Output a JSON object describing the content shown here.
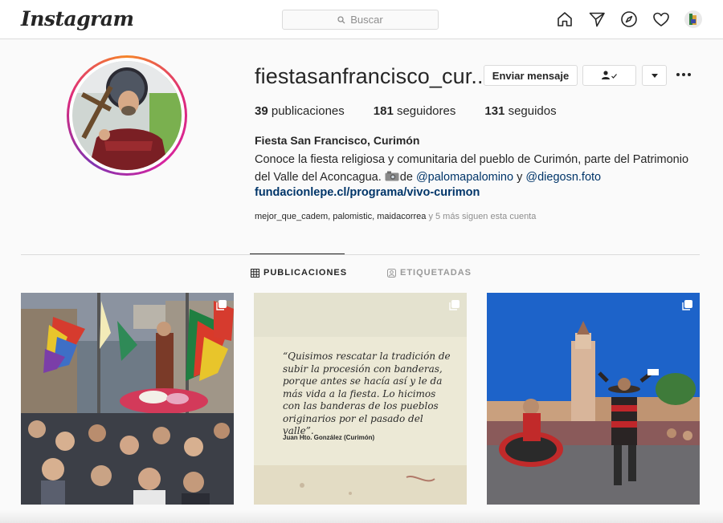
{
  "nav": {
    "logo": "Instagram",
    "search_placeholder": "Buscar",
    "icons": [
      "home-icon",
      "direct-icon",
      "explore-icon",
      "activity-icon",
      "profile-avatar"
    ]
  },
  "profile": {
    "username": "fiestasanfrancisco_cur...",
    "message_button": "Enviar mensaje",
    "stats": {
      "posts_count": "39",
      "posts_label": "publicaciones",
      "followers_count": "181",
      "followers_label": "seguidores",
      "following_count": "131",
      "following_label": "seguidos"
    },
    "full_name": "Fiesta San Francisco, Curimón",
    "bio_text": "Conoce la fiesta religiosa y comunitaria del pueblo de Curimón, parte del Patrimonio del Valle del Aconcagua. ",
    "bio_de": "de ",
    "bio_mention1": "@palomapalomino",
    "bio_y": " y ",
    "bio_mention2": "@diegosn.foto",
    "website": "fundacionlepe.cl/programa/vivo-curimon",
    "followed_by_names": "mejor_que_cadem, palomistic, maidacorrea",
    "followed_by_rest": " y 5 más siguen esta cuenta"
  },
  "tabs": {
    "posts": "PUBLICACIONES",
    "tagged": "ETIQUETADAS"
  },
  "posts": {
    "quote": "“Quisimos rescatar la tradición de subir la procesión con banderas, porque antes se hacía así y le da más vida a la fiesta. Lo hicimos con las banderas de los pueblos originarios por el pasado del valle”.",
    "quote_author": "Juan Hto. González (Curimón)"
  },
  "colors": {
    "link": "#003569",
    "muted": "#8e8e8e",
    "border": "#dbdbdb"
  }
}
